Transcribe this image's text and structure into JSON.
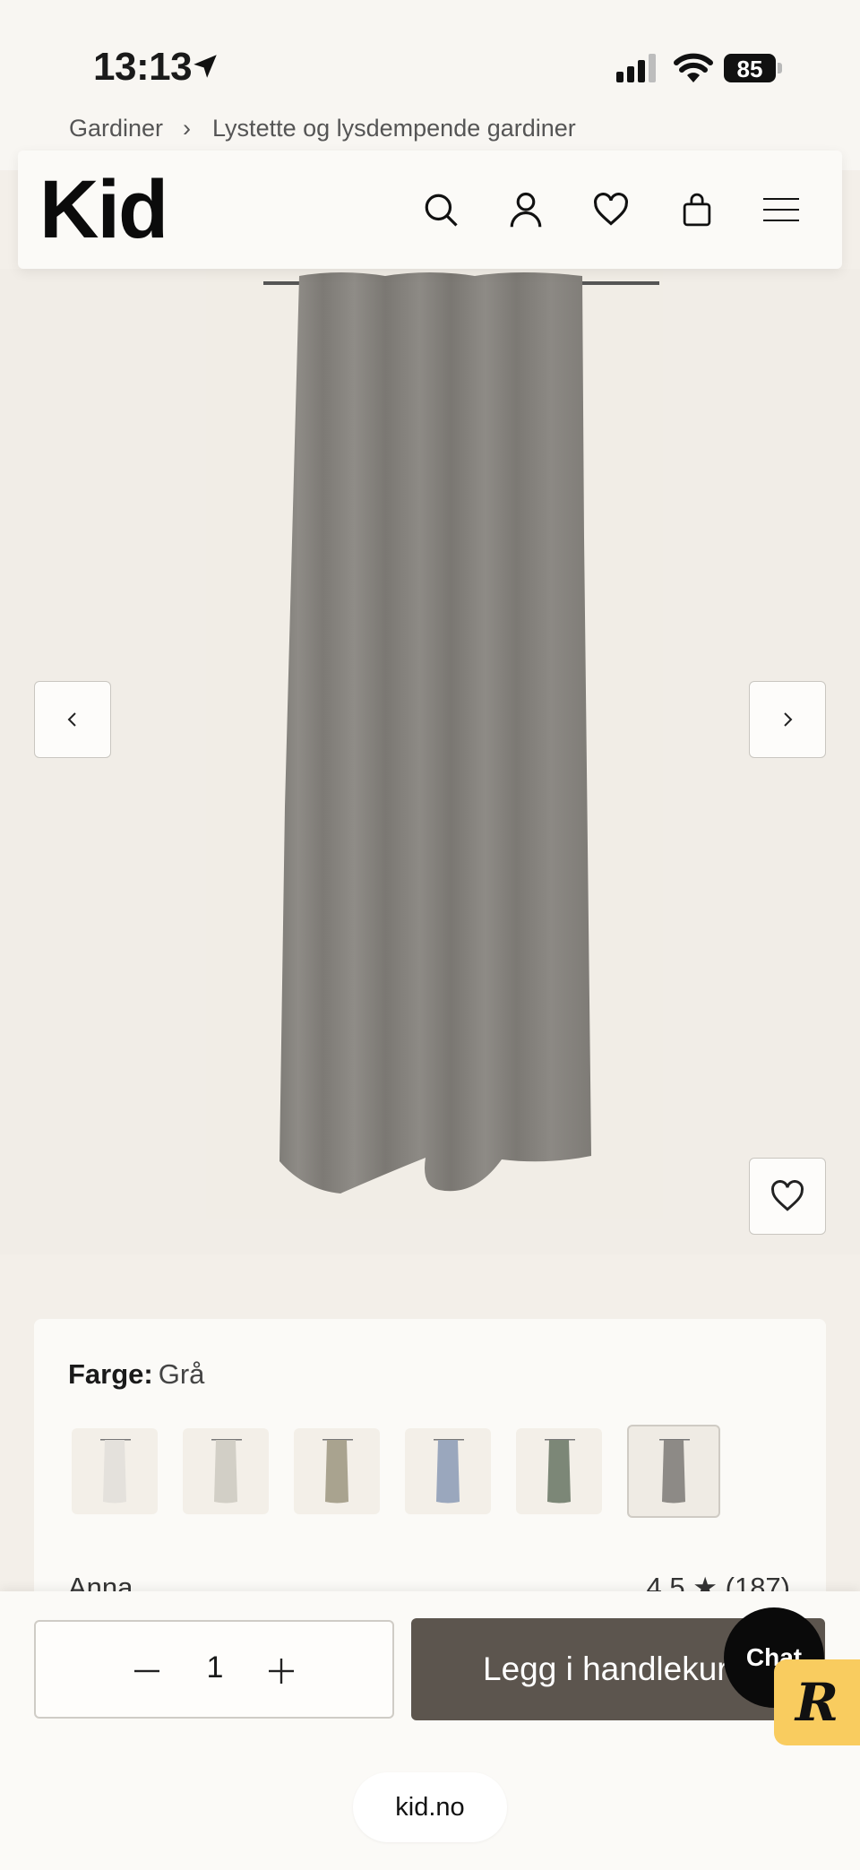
{
  "status_bar": {
    "time": "13:13",
    "battery": "85"
  },
  "breadcrumb": {
    "items": [
      "Gardiner",
      "Lystette og lysdempende gardiner"
    ],
    "separator": "›"
  },
  "header": {
    "logo": "Kid"
  },
  "product": {
    "color_label": "Farge:",
    "color_value": "Grå",
    "swatches": [
      {
        "color": "#e4e1dc"
      },
      {
        "color": "#d2cfc6"
      },
      {
        "color": "#a9a38f"
      },
      {
        "color": "#9aa7bd"
      },
      {
        "color": "#7c8777"
      },
      {
        "color": "#8d8a86"
      }
    ],
    "review_name": "Anna",
    "review_rating": "4,5 ★",
    "review_count": "(187)"
  },
  "cart": {
    "quantity": "1",
    "add_label": "Legg i handlekurv",
    "chat_label": "Chat"
  },
  "browser": {
    "url": "kid.no"
  },
  "colors": {
    "button": "#5c554e",
    "badge": "#f9cc5f"
  }
}
